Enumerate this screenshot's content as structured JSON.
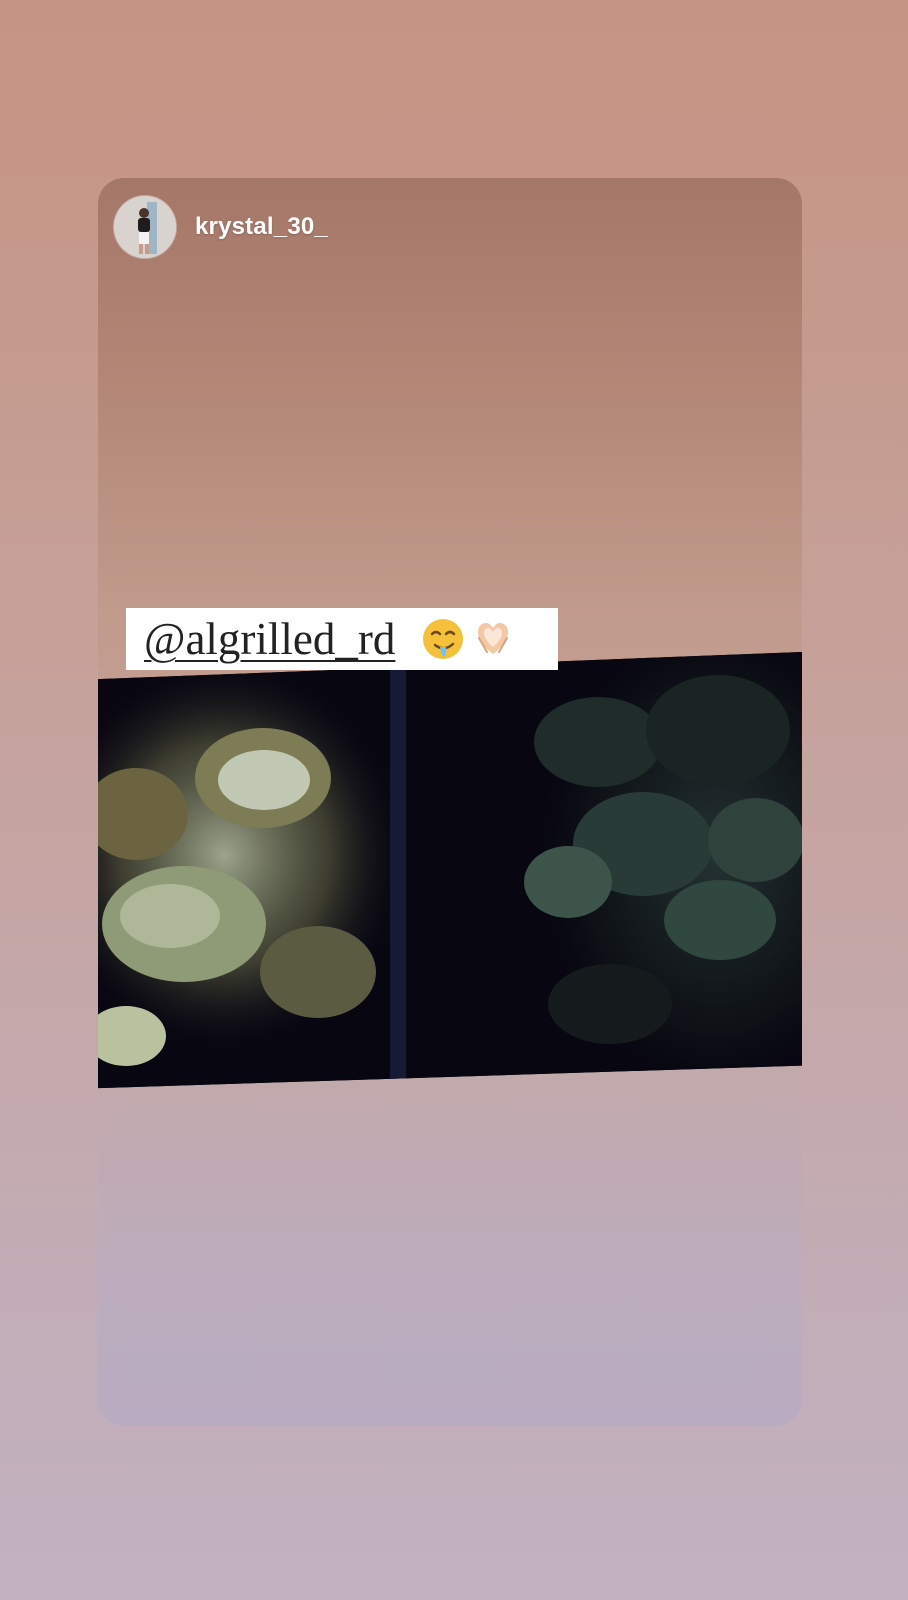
{
  "story": {
    "username": "krystal_30_",
    "avatar": "profile-avatar",
    "mention": {
      "text": "@algrilled_rd",
      "emojis": [
        "drooling-face-emoji",
        "heart-hands-emoji"
      ]
    },
    "photo": "food-photo"
  },
  "colors": {
    "background_top": "#c69484",
    "background_bottom": "#c3b1c1",
    "card_top": "#a47769",
    "card_bottom": "#b9abc1",
    "sticker_bg": "#ffffff",
    "photo_dark": "#070611"
  }
}
